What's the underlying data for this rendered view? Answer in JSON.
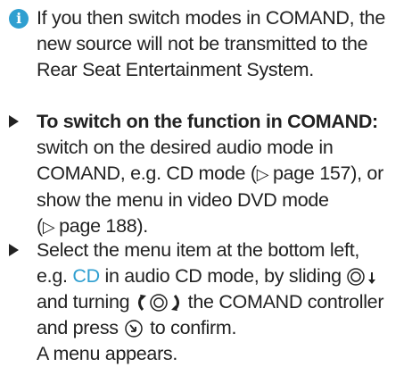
{
  "note": {
    "icon": "info-icon",
    "text": "If you then switch modes in COMAND, the new source will not be transmitted to the Rear Seat Entertainment System."
  },
  "step1": {
    "bold": "To switch on the function in COMAND:",
    "line1": "switch on the desired audio mode in",
    "line2": "COMAND, e.g. CD mode (",
    "ref1": "page 157",
    "line2b": "), or",
    "line3": "show the menu in video DVD mode",
    "line4a": "(",
    "ref2": "page 188",
    "line4b": ")."
  },
  "step2": {
    "line1": "Select the menu item at the bottom left,",
    "line2a": "e.g. ",
    "cd": "CD",
    "line2b": " in audio CD mode, by sliding",
    "line3a": "and turning",
    "line3b": "the COMAND controller",
    "line4a": "and press",
    "line4b": "to confirm.",
    "line5": "A menu appears."
  },
  "colors": {
    "accent": "#2f9fd0",
    "text": "#222222"
  }
}
